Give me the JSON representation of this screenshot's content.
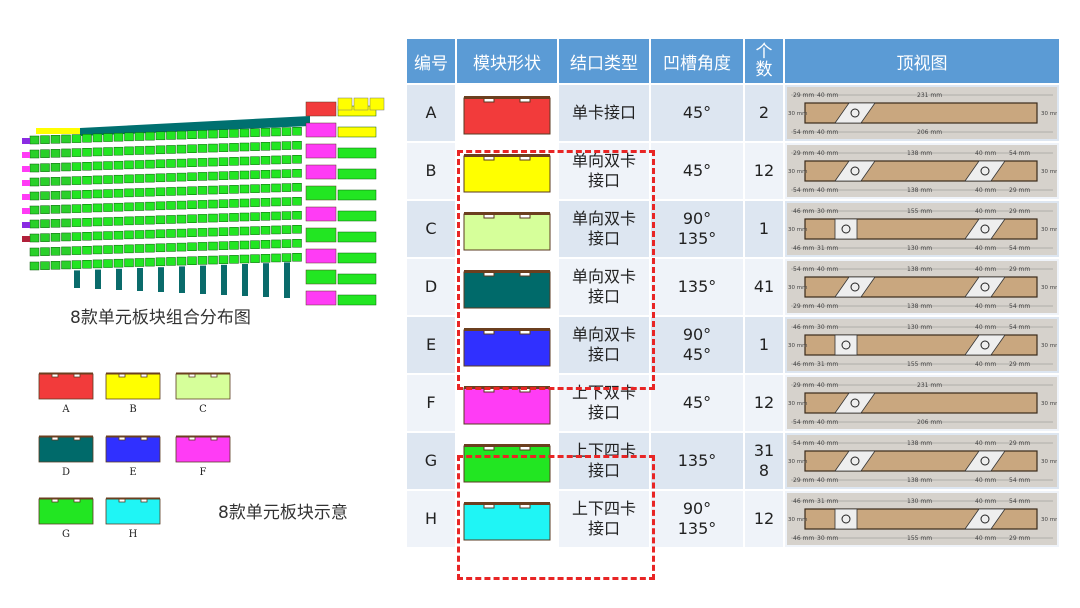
{
  "left": {
    "distribution_caption": "8款单元板块组合分布图",
    "swatch_caption": "8款单元板块示意",
    "swatches": [
      {
        "label": "A",
        "color": "#f23b3b"
      },
      {
        "label": "B",
        "color": "#ffff00"
      },
      {
        "label": "C",
        "color": "#d6ff9a"
      },
      {
        "label": "D",
        "color": "#006a6a"
      },
      {
        "label": "E",
        "color": "#3030ff"
      },
      {
        "label": "F",
        "color": "#ff3cf5"
      },
      {
        "label": "G",
        "color": "#22e622"
      },
      {
        "label": "H",
        "color": "#1ff5f5"
      }
    ]
  },
  "table": {
    "headers": [
      "编号",
      "模块形状",
      "结口类型",
      "凹槽角度",
      "个\n数",
      "顶视图"
    ],
    "rows": [
      {
        "id": "A",
        "color": "#f23b3b",
        "joint": "单卡接口",
        "angle": "45°",
        "count": "2",
        "dims_top": [
          "29 mm",
          "40 mm",
          "231 mm"
        ],
        "dims_bottom": [
          "54 mm",
          "40 mm",
          "206 mm"
        ],
        "side": [
          "30 mm",
          "30 mm"
        ]
      },
      {
        "id": "B",
        "color": "#ffff00",
        "joint": "单向双卡\n接口",
        "angle": "45°",
        "count": "12",
        "dims_top": [
          "29 mm",
          "40 mm",
          "138 mm",
          "40 mm",
          "54 mm"
        ],
        "dims_bottom": [
          "54 mm",
          "40 mm",
          "138 mm",
          "40 mm",
          "29 mm"
        ],
        "side": [
          "30 mm",
          "30 mm"
        ]
      },
      {
        "id": "C",
        "color": "#d6ff9a",
        "joint": "单向双卡\n接口",
        "angle": "90°\n135°",
        "count": "1",
        "dims_top": [
          "46 mm",
          "30 mm",
          "155 mm",
          "40 mm",
          "29 mm"
        ],
        "dims_bottom": [
          "46 mm",
          "31 mm",
          "130 mm",
          "40 mm",
          "54 mm"
        ],
        "side": [
          "30 mm",
          "30 mm"
        ]
      },
      {
        "id": "D",
        "color": "#006a6a",
        "joint": "单向双卡\n接口",
        "angle": "135°",
        "count": "41",
        "dims_top": [
          "54 mm",
          "40 mm",
          "138 mm",
          "40 mm",
          "29 mm"
        ],
        "dims_bottom": [
          "29 mm",
          "40 mm",
          "138 mm",
          "40 mm",
          "54 mm"
        ],
        "side": [
          "30 mm",
          "30 mm"
        ]
      },
      {
        "id": "E",
        "color": "#3030ff",
        "joint": "单向双卡\n接口",
        "angle": "90°\n45°",
        "count": "1",
        "dims_top": [
          "46 mm",
          "30 mm",
          "130 mm",
          "40 mm",
          "54 mm"
        ],
        "dims_bottom": [
          "46 mm",
          "31 mm",
          "155 mm",
          "40 mm",
          "29 mm"
        ],
        "side": [
          "30 mm",
          "30 mm"
        ]
      },
      {
        "id": "F",
        "color": "#ff3cf5",
        "joint": "上下双卡\n接口",
        "angle": "45°",
        "count": "12",
        "dims_top": [
          "29 mm",
          "40 mm",
          "231 mm"
        ],
        "dims_bottom": [
          "54 mm",
          "40 mm",
          "206 mm"
        ],
        "side": [
          "30 mm",
          "30 mm"
        ]
      },
      {
        "id": "G",
        "color": "#22e622",
        "joint": "上下四卡\n接口",
        "angle": "135°",
        "count": "31\n8",
        "dims_top": [
          "54 mm",
          "40 mm",
          "138 mm",
          "40 mm",
          "29 mm"
        ],
        "dims_bottom": [
          "29 mm",
          "40 mm",
          "138 mm",
          "40 mm",
          "54 mm"
        ],
        "side": [
          "30 mm",
          "30 mm"
        ]
      },
      {
        "id": "H",
        "color": "#1ff5f5",
        "joint": "上下四卡\n接口",
        "angle": "90°\n135°",
        "count": "12",
        "dims_top": [
          "46 mm",
          "31 mm",
          "130 mm",
          "40 mm",
          "54 mm"
        ],
        "dims_bottom": [
          "46 mm",
          "30 mm",
          "155 mm",
          "40 mm",
          "29 mm"
        ],
        "side": [
          "30 mm",
          "30 mm"
        ]
      }
    ]
  },
  "colors": {
    "header_bg": "#5b9bd5",
    "row_odd": "#dde6f1",
    "row_even": "#eff3f9",
    "dash": "#e82525",
    "wood": "#c9a77f"
  }
}
